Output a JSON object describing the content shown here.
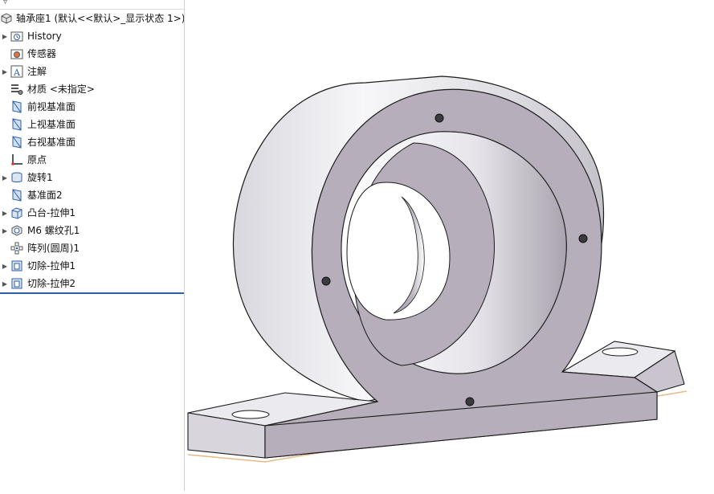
{
  "tree": {
    "filter_icon": "filter-icon",
    "root": {
      "label": "轴承座1  (默认<<默认>_显示状态 1>)",
      "icon": "part-icon"
    },
    "items": [
      {
        "label": "History",
        "icon": "history-folder-icon",
        "expandable": true
      },
      {
        "label": "传感器",
        "icon": "sensor-folder-icon",
        "expandable": false
      },
      {
        "label": "注解",
        "icon": "annotation-icon",
        "expandable": true
      },
      {
        "label": "材质 <未指定>",
        "icon": "material-icon",
        "expandable": false
      },
      {
        "label": "前视基准面",
        "icon": "plane-icon",
        "expandable": false
      },
      {
        "label": "上视基准面",
        "icon": "plane-icon",
        "expandable": false
      },
      {
        "label": "右视基准面",
        "icon": "plane-icon",
        "expandable": false
      },
      {
        "label": "原点",
        "icon": "origin-icon",
        "expandable": false
      },
      {
        "label": "旋转1",
        "icon": "revolve-icon",
        "expandable": true
      },
      {
        "label": "基准面2",
        "icon": "plane-icon",
        "expandable": false
      },
      {
        "label": "凸台-拉伸1",
        "icon": "boss-extrude-icon",
        "expandable": true
      },
      {
        "label": "M6 螺纹孔1",
        "icon": "hole-wizard-icon",
        "expandable": true
      },
      {
        "label": "阵列(圆周)1",
        "icon": "circular-pattern-icon",
        "expandable": false
      },
      {
        "label": "切除-拉伸1",
        "icon": "cut-extrude-icon",
        "expandable": true
      },
      {
        "label": "切除-拉伸2",
        "icon": "cut-extrude-icon",
        "expandable": true
      }
    ]
  },
  "colors": {
    "model_face": "#b7aebb",
    "model_light": "#ebeaee",
    "model_edge": "#1a1a1a",
    "selection_line": "#2f5ea8",
    "floor": "#e8b987"
  }
}
